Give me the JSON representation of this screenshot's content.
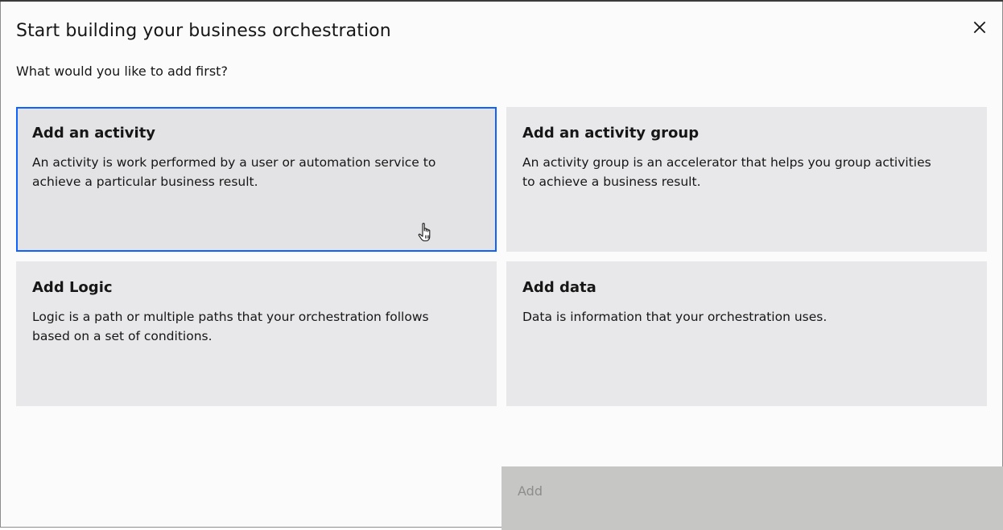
{
  "modal": {
    "title": "Start building your business orchestration",
    "subtitle": "What would you like to add first?",
    "close_icon": "close-icon"
  },
  "tiles": [
    {
      "title": "Add an activity",
      "description": "An activity is work performed by a user or automation service to achieve a particular business result.",
      "selected": true
    },
    {
      "title": "Add an activity group",
      "description": "An activity group is an accelerator that helps you group activities to achieve a business result.",
      "selected": false
    },
    {
      "title": "Add Logic",
      "description": "Logic is a path or multiple paths that your orchestration follows based on a set of conditions.",
      "selected": false
    },
    {
      "title": "Add data",
      "description": "Data is information that your orchestration uses.",
      "selected": false
    }
  ],
  "footer": {
    "add_label": "Add",
    "add_disabled": true
  },
  "colors": {
    "selected_border": "#0f62fe",
    "tile_background": "#e8e8ea",
    "disabled_button": "#c6c6c4"
  }
}
